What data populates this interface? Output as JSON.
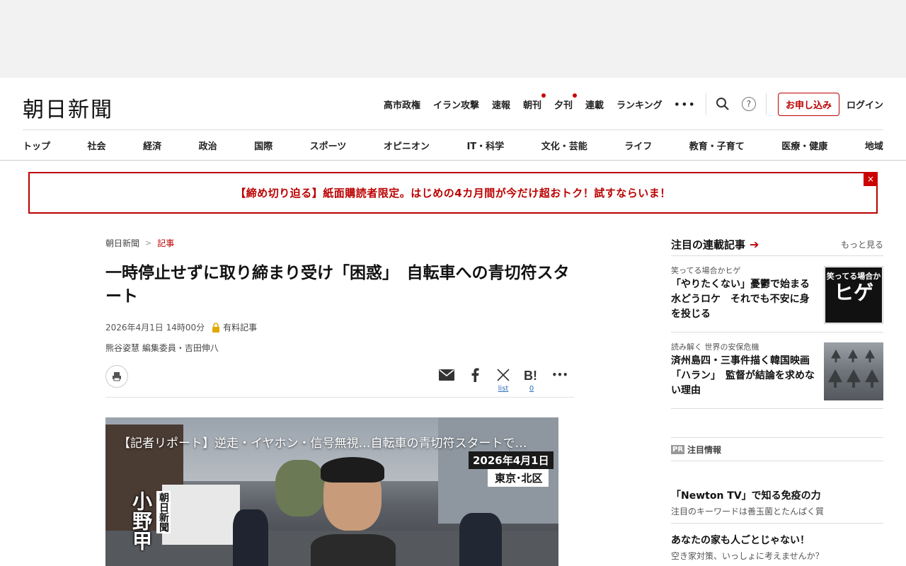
{
  "logo": "朝日新聞",
  "topnav": {
    "items": [
      {
        "label": "高市政権",
        "dot": false
      },
      {
        "label": "イラン攻撃",
        "dot": false
      },
      {
        "label": "速報",
        "dot": false
      },
      {
        "label": "朝刊",
        "dot": true
      },
      {
        "label": "夕刊",
        "dot": true
      },
      {
        "label": "連載",
        "dot": false
      },
      {
        "label": "ランキング",
        "dot": false
      }
    ],
    "more": "•••",
    "help": "?",
    "subscribe": "お申し込み",
    "login": "ログイン"
  },
  "categories": [
    "トップ",
    "社会",
    "経済",
    "政治",
    "国際",
    "スポーツ",
    "オピニオン",
    "IT・科学",
    "文化・芸能",
    "ライフ",
    "教育・子育て",
    "医療・健康",
    "地域"
  ],
  "promo": {
    "text": "【締め切り迫る】紙面購読者限定。はじめの4カ月間が今だけ超おトク！試すならいま！",
    "close": "×"
  },
  "article": {
    "breadcrumb": [
      "朝日新聞",
      "記事"
    ],
    "breadcrumb_sep": ">",
    "title": "一時停止せずに取り締まり受け「困惑」　自転車への青切符スタート",
    "datetime": "2026年4月1日 14時00分",
    "paid_label": "有料記事",
    "authors": "熊谷姿慧 編集委員・吉田伸八",
    "share": {
      "x_count": "list",
      "hatena_count": "0",
      "more": "•••"
    },
    "video": {
      "title": "【記者リポート】逆走・イヤホン・信号無視…自転車の青切符スタートで…",
      "date": "2026年4月1日",
      "location": "東京･北区",
      "logo_text": "朝日新聞",
      "reporter": "小野甲"
    }
  },
  "sidebar": {
    "title": "注目の連載記事",
    "more": "もっと見る",
    "items": [
      {
        "series": "笑ってる場合かヒゲ",
        "headline": "「やりたくない」憂鬱で始まる水どうロケ　それでも不安に身を投じる",
        "thumb_small": "笑ってる場合か",
        "thumb_big": "ヒゲ"
      },
      {
        "series": "読み解く 世界の安保危機",
        "headline": "済州島四・三事件描く韓国映画「ハラン」　監督が結論を求めない理由"
      }
    ]
  },
  "pr": {
    "badge": "PR",
    "label": "注目情報",
    "items": [
      {
        "headline": "「Newton TV」で知る免疫の力",
        "sub": "注目のキーワードは善玉菌とたんぱく質"
      },
      {
        "headline": "あなたの家も人ごとじゃない！",
        "sub": "空き家対策、いっしょに考えませんか？"
      }
    ]
  }
}
